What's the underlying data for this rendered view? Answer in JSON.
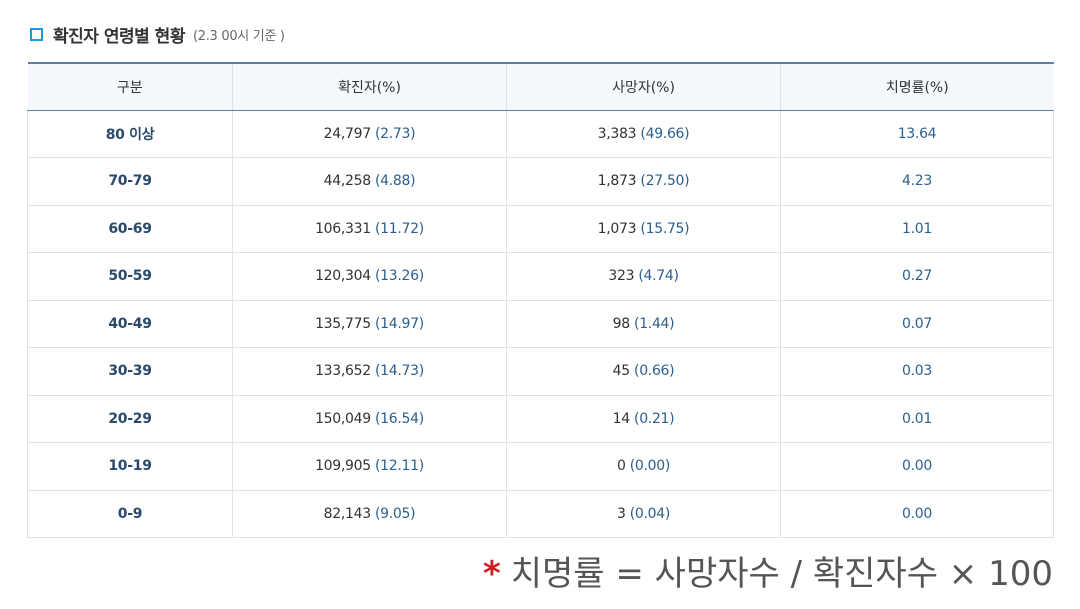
{
  "header": {
    "title": "확진자 연령별 현황",
    "subtitle": "(2.3 00시 기준 )"
  },
  "table": {
    "columns": [
      "구분",
      "확진자(%)",
      "사망자(%)",
      "치명률(%)"
    ],
    "rows": [
      {
        "age": "80 이상",
        "conf": "24,797",
        "conf_pct": "(2.73)",
        "death": "3,383",
        "death_pct": "(49.66)",
        "fatality": "13.64"
      },
      {
        "age": "70-79",
        "conf": "44,258",
        "conf_pct": "(4.88)",
        "death": "1,873",
        "death_pct": "(27.50)",
        "fatality": "4.23"
      },
      {
        "age": "60-69",
        "conf": "106,331",
        "conf_pct": "(11.72)",
        "death": "1,073",
        "death_pct": "(15.75)",
        "fatality": "1.01"
      },
      {
        "age": "50-59",
        "conf": "120,304",
        "conf_pct": "(13.26)",
        "death": "323",
        "death_pct": "(4.74)",
        "fatality": "0.27"
      },
      {
        "age": "40-49",
        "conf": "135,775",
        "conf_pct": "(14.97)",
        "death": "98",
        "death_pct": "(1.44)",
        "fatality": "0.07"
      },
      {
        "age": "30-39",
        "conf": "133,652",
        "conf_pct": "(14.73)",
        "death": "45",
        "death_pct": "(0.66)",
        "fatality": "0.03"
      },
      {
        "age": "20-29",
        "conf": "150,049",
        "conf_pct": "(16.54)",
        "death": "14",
        "death_pct": "(0.21)",
        "fatality": "0.01"
      },
      {
        "age": "10-19",
        "conf": "109,905",
        "conf_pct": "(12.11)",
        "death": "0",
        "death_pct": "(0.00)",
        "fatality": "0.00"
      },
      {
        "age": "0-9",
        "conf": "82,143",
        "conf_pct": "(9.05)",
        "death": "3",
        "death_pct": "(0.04)",
        "fatality": "0.00"
      }
    ]
  },
  "footnote": {
    "star": "*",
    "formula": "치명률 = 사망자수 / 확진자수 × 100"
  },
  "colors": {
    "accent": "#1e9bd7",
    "header_border": "#5c7fa8",
    "star": "#cc1f1f"
  }
}
